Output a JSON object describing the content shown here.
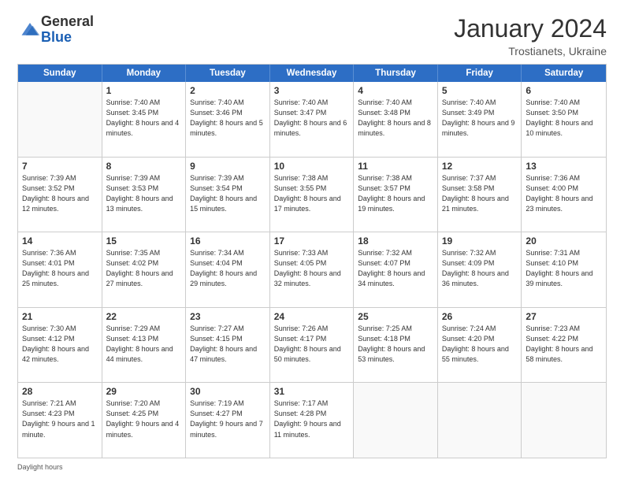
{
  "logo": {
    "general": "General",
    "blue": "Blue"
  },
  "header": {
    "month": "January 2024",
    "location": "Trostianets, Ukraine"
  },
  "days": [
    "Sunday",
    "Monday",
    "Tuesday",
    "Wednesday",
    "Thursday",
    "Friday",
    "Saturday"
  ],
  "footer": "Daylight hours",
  "weeks": [
    [
      {
        "day": "",
        "sunrise": "",
        "sunset": "",
        "daylight": ""
      },
      {
        "day": "1",
        "sunrise": "Sunrise: 7:40 AM",
        "sunset": "Sunset: 3:45 PM",
        "daylight": "Daylight: 8 hours and 4 minutes."
      },
      {
        "day": "2",
        "sunrise": "Sunrise: 7:40 AM",
        "sunset": "Sunset: 3:46 PM",
        "daylight": "Daylight: 8 hours and 5 minutes."
      },
      {
        "day": "3",
        "sunrise": "Sunrise: 7:40 AM",
        "sunset": "Sunset: 3:47 PM",
        "daylight": "Daylight: 8 hours and 6 minutes."
      },
      {
        "day": "4",
        "sunrise": "Sunrise: 7:40 AM",
        "sunset": "Sunset: 3:48 PM",
        "daylight": "Daylight: 8 hours and 8 minutes."
      },
      {
        "day": "5",
        "sunrise": "Sunrise: 7:40 AM",
        "sunset": "Sunset: 3:49 PM",
        "daylight": "Daylight: 8 hours and 9 minutes."
      },
      {
        "day": "6",
        "sunrise": "Sunrise: 7:40 AM",
        "sunset": "Sunset: 3:50 PM",
        "daylight": "Daylight: 8 hours and 10 minutes."
      }
    ],
    [
      {
        "day": "7",
        "sunrise": "Sunrise: 7:39 AM",
        "sunset": "Sunset: 3:52 PM",
        "daylight": "Daylight: 8 hours and 12 minutes."
      },
      {
        "day": "8",
        "sunrise": "Sunrise: 7:39 AM",
        "sunset": "Sunset: 3:53 PM",
        "daylight": "Daylight: 8 hours and 13 minutes."
      },
      {
        "day": "9",
        "sunrise": "Sunrise: 7:39 AM",
        "sunset": "Sunset: 3:54 PM",
        "daylight": "Daylight: 8 hours and 15 minutes."
      },
      {
        "day": "10",
        "sunrise": "Sunrise: 7:38 AM",
        "sunset": "Sunset: 3:55 PM",
        "daylight": "Daylight: 8 hours and 17 minutes."
      },
      {
        "day": "11",
        "sunrise": "Sunrise: 7:38 AM",
        "sunset": "Sunset: 3:57 PM",
        "daylight": "Daylight: 8 hours and 19 minutes."
      },
      {
        "day": "12",
        "sunrise": "Sunrise: 7:37 AM",
        "sunset": "Sunset: 3:58 PM",
        "daylight": "Daylight: 8 hours and 21 minutes."
      },
      {
        "day": "13",
        "sunrise": "Sunrise: 7:36 AM",
        "sunset": "Sunset: 4:00 PM",
        "daylight": "Daylight: 8 hours and 23 minutes."
      }
    ],
    [
      {
        "day": "14",
        "sunrise": "Sunrise: 7:36 AM",
        "sunset": "Sunset: 4:01 PM",
        "daylight": "Daylight: 8 hours and 25 minutes."
      },
      {
        "day": "15",
        "sunrise": "Sunrise: 7:35 AM",
        "sunset": "Sunset: 4:02 PM",
        "daylight": "Daylight: 8 hours and 27 minutes."
      },
      {
        "day": "16",
        "sunrise": "Sunrise: 7:34 AM",
        "sunset": "Sunset: 4:04 PM",
        "daylight": "Daylight: 8 hours and 29 minutes."
      },
      {
        "day": "17",
        "sunrise": "Sunrise: 7:33 AM",
        "sunset": "Sunset: 4:05 PM",
        "daylight": "Daylight: 8 hours and 32 minutes."
      },
      {
        "day": "18",
        "sunrise": "Sunrise: 7:32 AM",
        "sunset": "Sunset: 4:07 PM",
        "daylight": "Daylight: 8 hours and 34 minutes."
      },
      {
        "day": "19",
        "sunrise": "Sunrise: 7:32 AM",
        "sunset": "Sunset: 4:09 PM",
        "daylight": "Daylight: 8 hours and 36 minutes."
      },
      {
        "day": "20",
        "sunrise": "Sunrise: 7:31 AM",
        "sunset": "Sunset: 4:10 PM",
        "daylight": "Daylight: 8 hours and 39 minutes."
      }
    ],
    [
      {
        "day": "21",
        "sunrise": "Sunrise: 7:30 AM",
        "sunset": "Sunset: 4:12 PM",
        "daylight": "Daylight: 8 hours and 42 minutes."
      },
      {
        "day": "22",
        "sunrise": "Sunrise: 7:29 AM",
        "sunset": "Sunset: 4:13 PM",
        "daylight": "Daylight: 8 hours and 44 minutes."
      },
      {
        "day": "23",
        "sunrise": "Sunrise: 7:27 AM",
        "sunset": "Sunset: 4:15 PM",
        "daylight": "Daylight: 8 hours and 47 minutes."
      },
      {
        "day": "24",
        "sunrise": "Sunrise: 7:26 AM",
        "sunset": "Sunset: 4:17 PM",
        "daylight": "Daylight: 8 hours and 50 minutes."
      },
      {
        "day": "25",
        "sunrise": "Sunrise: 7:25 AM",
        "sunset": "Sunset: 4:18 PM",
        "daylight": "Daylight: 8 hours and 53 minutes."
      },
      {
        "day": "26",
        "sunrise": "Sunrise: 7:24 AM",
        "sunset": "Sunset: 4:20 PM",
        "daylight": "Daylight: 8 hours and 55 minutes."
      },
      {
        "day": "27",
        "sunrise": "Sunrise: 7:23 AM",
        "sunset": "Sunset: 4:22 PM",
        "daylight": "Daylight: 8 hours and 58 minutes."
      }
    ],
    [
      {
        "day": "28",
        "sunrise": "Sunrise: 7:21 AM",
        "sunset": "Sunset: 4:23 PM",
        "daylight": "Daylight: 9 hours and 1 minute."
      },
      {
        "day": "29",
        "sunrise": "Sunrise: 7:20 AM",
        "sunset": "Sunset: 4:25 PM",
        "daylight": "Daylight: 9 hours and 4 minutes."
      },
      {
        "day": "30",
        "sunrise": "Sunrise: 7:19 AM",
        "sunset": "Sunset: 4:27 PM",
        "daylight": "Daylight: 9 hours and 7 minutes."
      },
      {
        "day": "31",
        "sunrise": "Sunrise: 7:17 AM",
        "sunset": "Sunset: 4:28 PM",
        "daylight": "Daylight: 9 hours and 11 minutes."
      },
      {
        "day": "",
        "sunrise": "",
        "sunset": "",
        "daylight": ""
      },
      {
        "day": "",
        "sunrise": "",
        "sunset": "",
        "daylight": ""
      },
      {
        "day": "",
        "sunrise": "",
        "sunset": "",
        "daylight": ""
      }
    ]
  ]
}
